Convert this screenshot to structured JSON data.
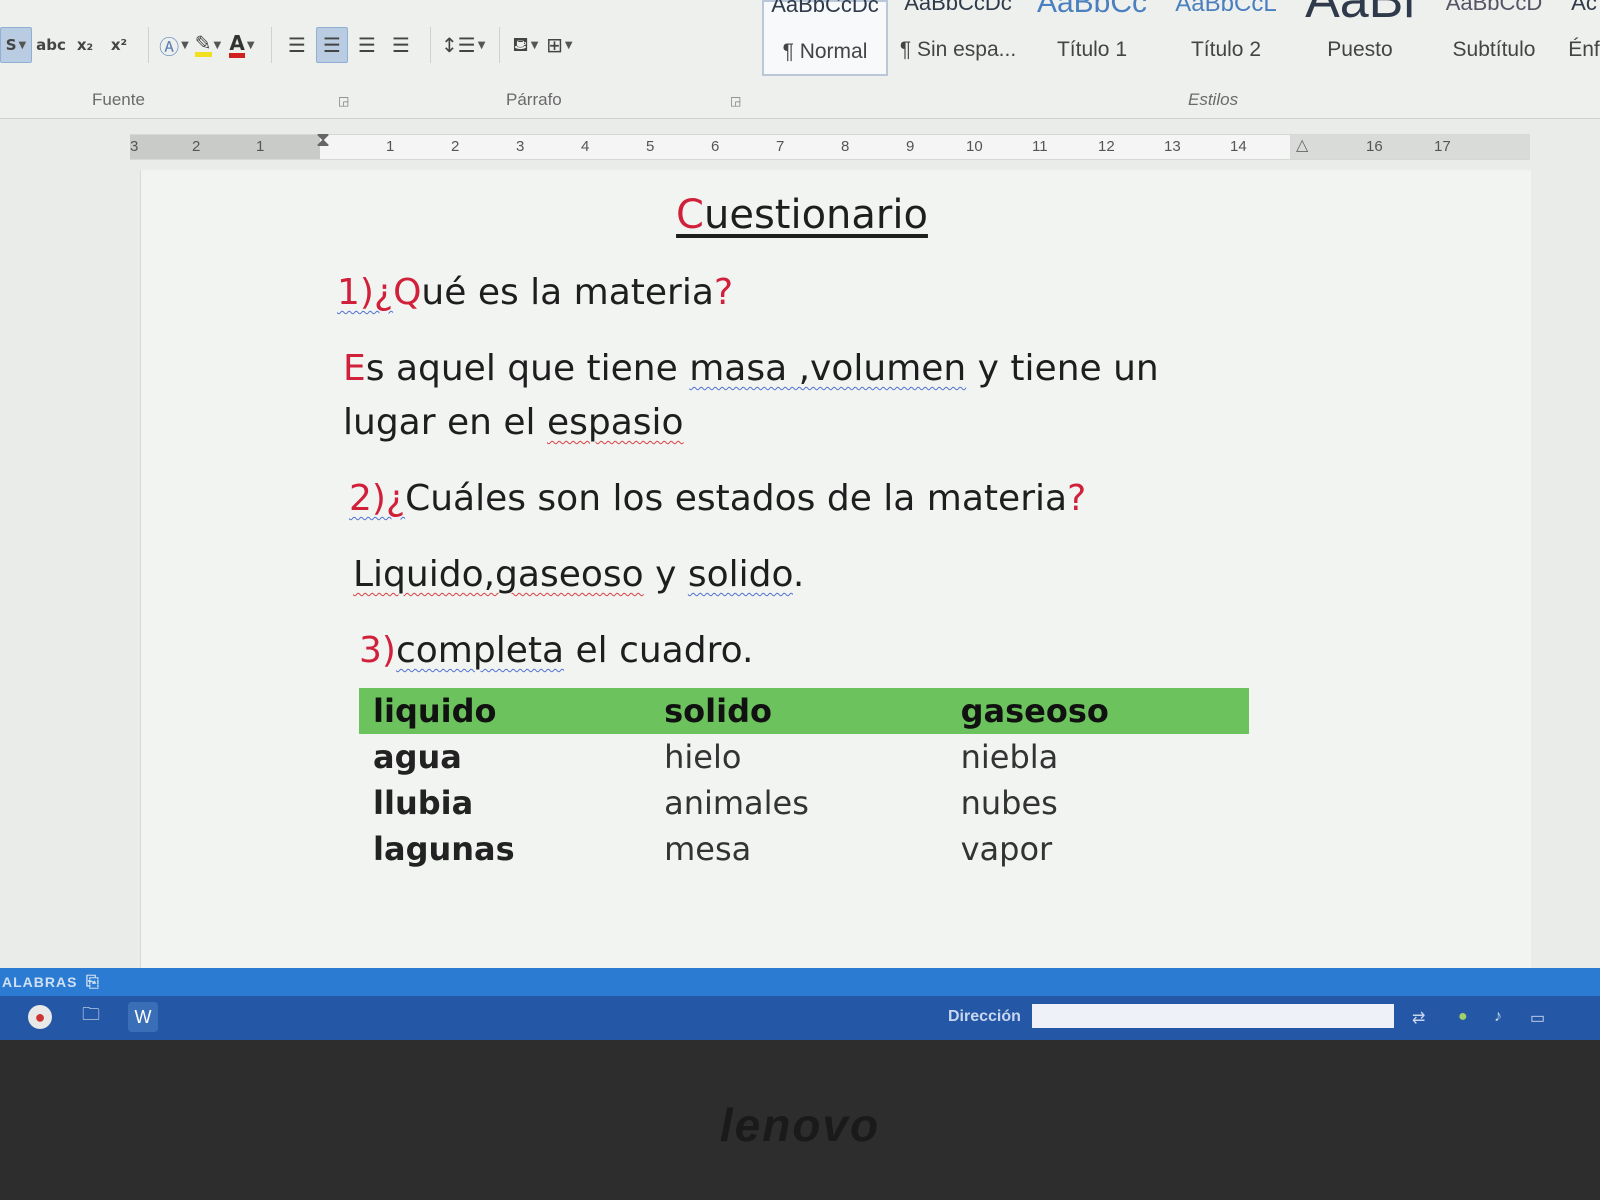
{
  "ribbon": {
    "groups": {
      "font": "Fuente",
      "paragraph": "Párrafo",
      "styles": "Estilos"
    },
    "font_buttons": {
      "strike_label": "abc",
      "subscript_label": "x₂",
      "superscript_label": "x²"
    },
    "style_items": [
      {
        "sample": "AaBbCcDc",
        "name": "¶ Normal",
        "selected": true
      },
      {
        "sample": "AaBbCcDc",
        "name": "¶ Sin espa...",
        "selected": false
      },
      {
        "sample": "AaBbCc",
        "name": "Título 1",
        "selected": false
      },
      {
        "sample": "AaBbCcL",
        "name": "Título 2",
        "selected": false
      },
      {
        "sample": "AaBl",
        "name": "Puesto",
        "selected": false
      },
      {
        "sample": "AaBbCcD",
        "name": "Subtítulo",
        "selected": false
      },
      {
        "sample": "Ac",
        "name": "Énf",
        "selected": false
      }
    ]
  },
  "ruler": {
    "left_numbers": [
      "3",
      "2",
      "1"
    ],
    "numbers": [
      "1",
      "2",
      "3",
      "4",
      "5",
      "6",
      "7",
      "8",
      "9",
      "10",
      "11",
      "12",
      "13",
      "14",
      "16",
      "17"
    ]
  },
  "document": {
    "title": "Cuestionario",
    "q1": {
      "num": "1)¿",
      "q_cap": "Q",
      "text": "ué  es la materia",
      "mark": "?"
    },
    "a1": {
      "cap": "E",
      "part1": "s aquel que tiene ",
      "underlined": "masa ,volumen",
      "part2": " y tiene un lugar en el ",
      "misspelled": "espasio"
    },
    "q2": {
      "num": "2)¿",
      "text": "Cuáles son los estados de la materia",
      "mark": "?"
    },
    "a2": {
      "underlined": "Liquido,gaseoso",
      "part2": " y ",
      "solid": "solido",
      "end": "."
    },
    "q3": {
      "num": "3)",
      "underlined": "completa",
      "text": " el cuadro."
    },
    "table": {
      "headers": [
        "liquido",
        "solido",
        "gaseoso"
      ],
      "rows": [
        [
          "agua",
          "hielo",
          "niebla"
        ],
        [
          "llubia",
          "animales",
          "nubes"
        ],
        [
          "lagunas",
          "mesa",
          "vapor"
        ]
      ]
    }
  },
  "statusbar": {
    "text": "ALABRAS"
  },
  "taskbar": {
    "address_label": "Dirección",
    "address_value": ""
  },
  "bezel": {
    "brand": "lenovo"
  },
  "colors": {
    "accent_red": "#d0203a",
    "table_header": "#6cc25c",
    "taskbar": "#2458a6"
  }
}
